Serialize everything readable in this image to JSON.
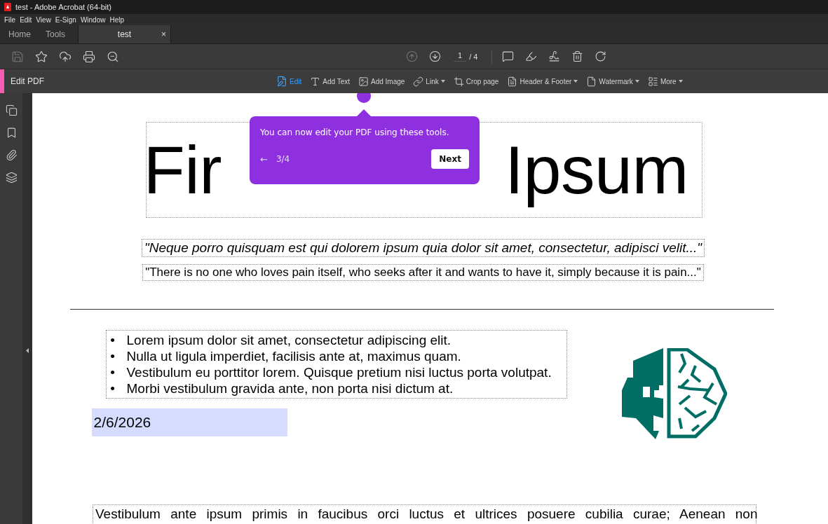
{
  "window": {
    "title": "test - Adobe Acrobat (64-bit)"
  },
  "menu": [
    "File",
    "Edit",
    "View",
    "E-Sign",
    "Window",
    "Help"
  ],
  "tabs": [
    {
      "label": "Home",
      "selected": false,
      "closable": false
    },
    {
      "label": "Tools",
      "selected": false,
      "closable": false
    },
    {
      "label": "test",
      "selected": true,
      "closable": true
    }
  ],
  "tab_close": "×",
  "toolbar": {
    "page_current": "1",
    "page_total": "/ 4"
  },
  "edit_bar": {
    "title": "Edit PDF",
    "tools": [
      {
        "kind": "edit",
        "label": "Edit",
        "selected": true,
        "dropdown": false
      },
      {
        "kind": "text",
        "label": "Add Text",
        "selected": false,
        "dropdown": false
      },
      {
        "kind": "image",
        "label": "Add Image",
        "selected": false,
        "dropdown": false
      },
      {
        "kind": "link",
        "label": "Link",
        "selected": false,
        "dropdown": true
      },
      {
        "kind": "crop",
        "label": "Crop page",
        "selected": false,
        "dropdown": false
      },
      {
        "kind": "header",
        "label": "Header & Footer",
        "selected": false,
        "dropdown": true
      },
      {
        "kind": "watermark",
        "label": "Watermark",
        "selected": false,
        "dropdown": true
      },
      {
        "kind": "more",
        "label": "More",
        "selected": false,
        "dropdown": true
      }
    ]
  },
  "tour": {
    "message": "You can now edit your PDF using these tools.",
    "back": "←",
    "step": "3/4",
    "next": "Next"
  },
  "document": {
    "heading": [
      "Fir",
      "Ipsum"
    ],
    "quotes": [
      {
        "text": "\"Neque porro quisquam est qui dolorem ipsum quia dolor sit amet, consectetur, adipisci velit...\"",
        "italic": true
      },
      {
        "text": "\"There is no one who loves pain itself, who seeks after it and wants to have it, simply because it is pain...\"",
        "italic": false
      }
    ],
    "bullet_marker": "•",
    "bullets": [
      "Lorem ipsum dolor sit amet, consectetur adipiscing elit.",
      "Nulla ut ligula imperdiet, facilisis ante at, maximus quam.",
      "Vestibulum eu porttitor lorem. Quisque pretium nisi luctus porta volutpat.",
      "Morbi vestibulum gravida ante, non porta nisi dictum at."
    ],
    "date": "2/6/2026",
    "paragraph": "Vestibulum ante ipsum primis in faucibus orci luctus et ultrices posuere cubilia curae; Aenean non"
  }
}
